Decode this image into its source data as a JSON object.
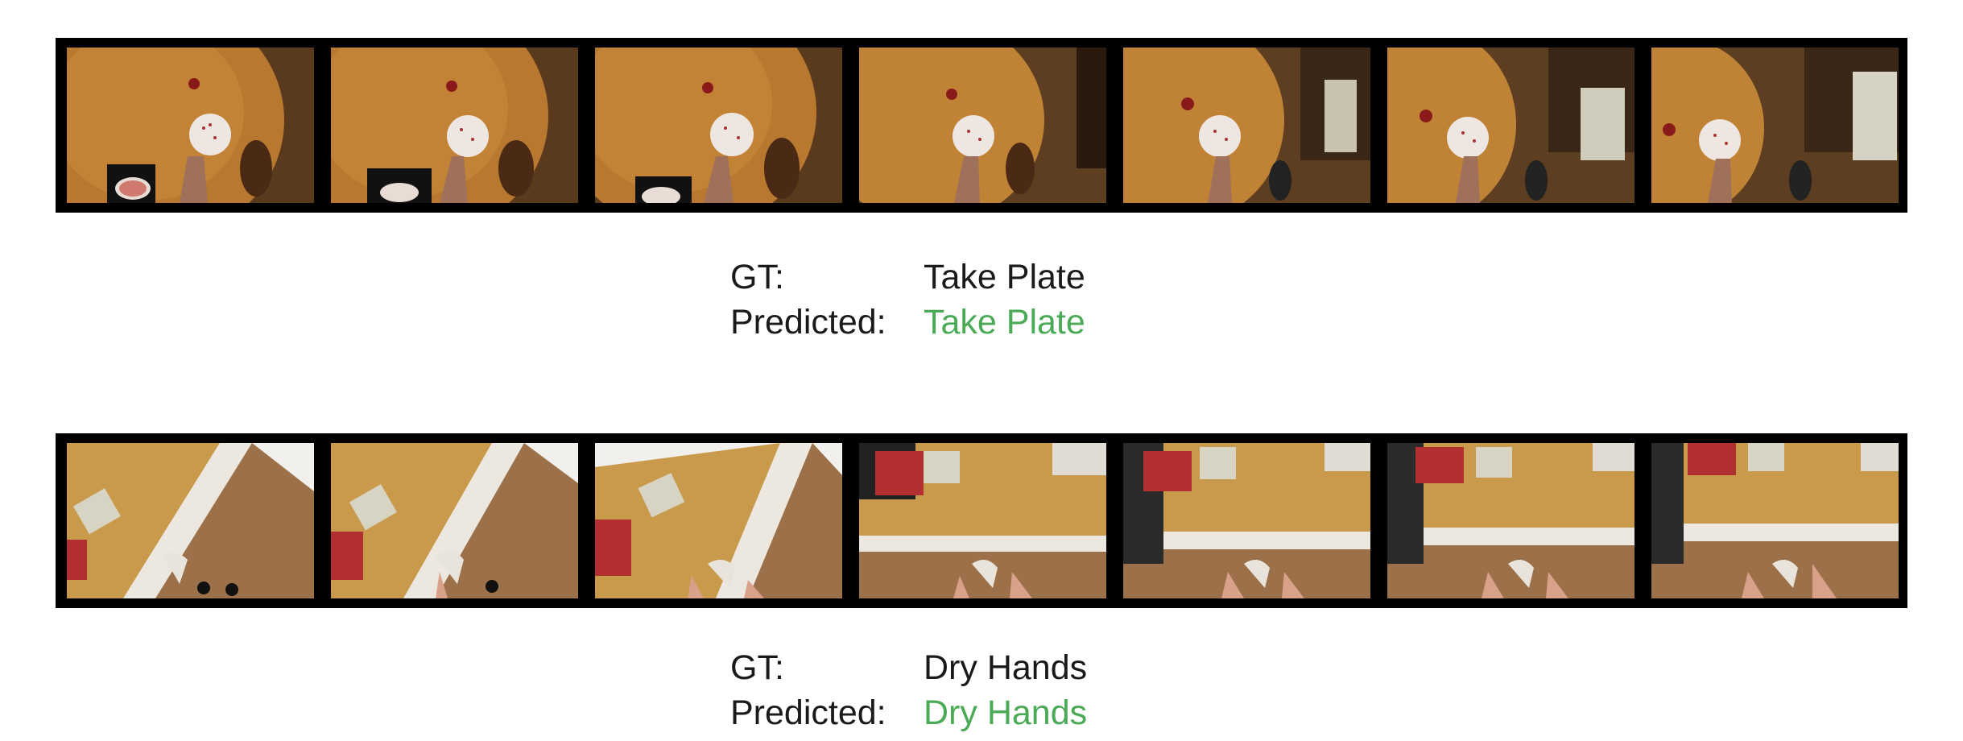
{
  "examples": [
    {
      "gt_label": "GT:",
      "gt_value": "Take Plate",
      "pred_label": "Predicted:",
      "pred_value": "Take Plate",
      "pred_color": "#4aaa55",
      "scene": "wooden table with spotted plate, top-down egocentric view",
      "frame_count": 7
    },
    {
      "gt_label": "GT:",
      "gt_value": "Dry Hands",
      "pred_label": "Predicted:",
      "pred_value": "Dry Hands",
      "pred_color": "#4aaa55",
      "scene": "kitchen counter and floor, hands holding towel, egocentric view",
      "frame_count": 7
    }
  ]
}
